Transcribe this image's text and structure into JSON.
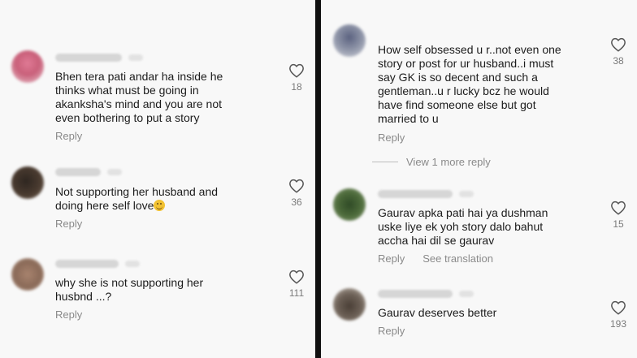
{
  "left_panel": {
    "comments": [
      {
        "text": "Bhen tera pati andar ha inside he\nthinks what must be going in\nakanksha's mind and you are not\neven bothering to put a story",
        "reply_label": "Reply",
        "like_count": "18",
        "avatar_color": "#c9607a"
      },
      {
        "text": "Not supporting her husband and\ndoing here self love",
        "reply_label": "Reply",
        "like_count": "36",
        "avatar_color": "#4a3b30"
      },
      {
        "text": "why she is not supporting her\nhusbnd ...?",
        "reply_label": "Reply",
        "like_count": "111",
        "avatar_color": "#8a6a58"
      }
    ]
  },
  "right_panel": {
    "comments": [
      {
        "text": "How self obsessed u r..not even one\nstory or post for ur husband..i must\nsay GK is so decent and such a\ngentleman..u r lucky bcz he would\nhave find someone else but got\nmarried to u",
        "reply_label": "Reply",
        "like_count": "38",
        "avatar_color": "#8f95a8"
      },
      {
        "text": "Gaurav apka pati hai ya dushman\nuske liye ek yoh story dalo bahut\naccha hai dil se gaurav",
        "reply_label": "Reply",
        "translate_label": "See translation",
        "like_count": "15",
        "avatar_color": "#4c6a3a"
      },
      {
        "text": "Gaurav deserves better",
        "reply_label": "Reply",
        "like_count": "193",
        "avatar_color": "#6e6258"
      }
    ],
    "view_more_label": "View 1 more reply"
  },
  "icons": {
    "like": "heart-outline-icon",
    "emoji": "smiling-face-emoji"
  },
  "colors": {
    "text": "#1c1c1c",
    "muted": "#8a8a8a",
    "divider": "#111111"
  }
}
